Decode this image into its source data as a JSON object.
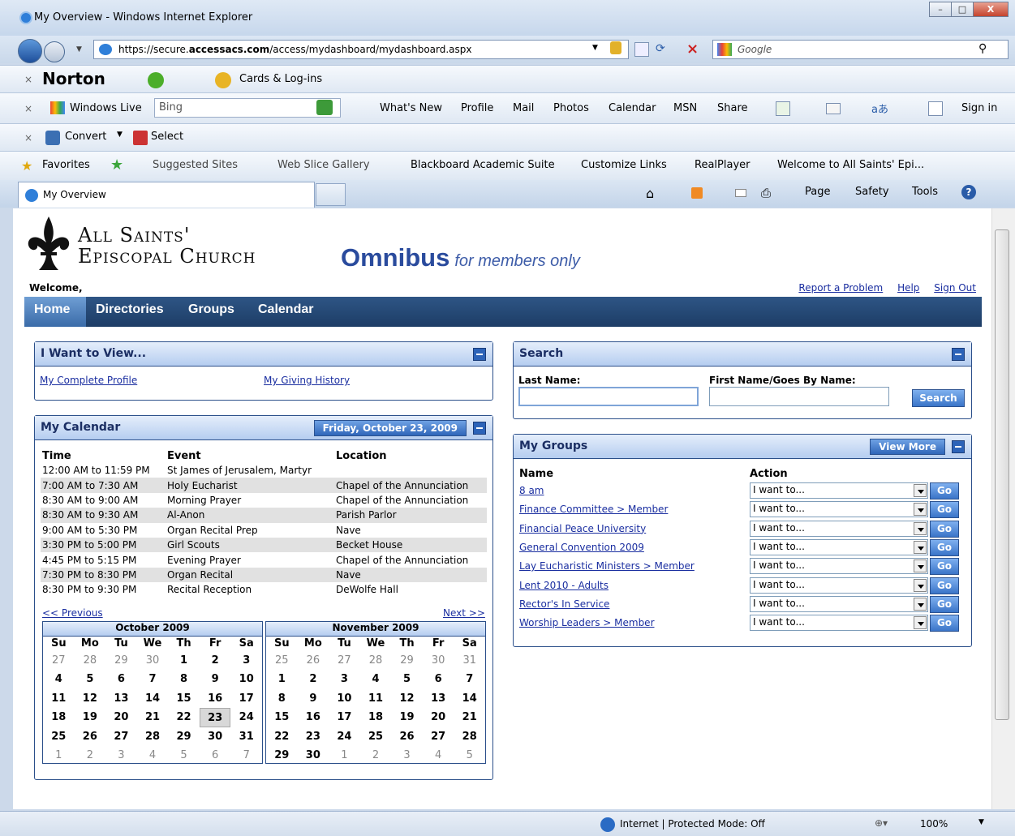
{
  "window": {
    "title": "My Overview - Windows Internet Explorer",
    "minimize": "–",
    "maximize": "□",
    "close": "X"
  },
  "address": {
    "prefix": "https://secure.",
    "domain": "accessacs.com",
    "path": "/access/mydashboard/mydashboard.aspx"
  },
  "search_engine": {
    "placeholder": "Google"
  },
  "norton": {
    "brand": "Norton",
    "cards": "Cards & Log-ins"
  },
  "live": {
    "brand": "Windows Live",
    "search": "Bing",
    "items": [
      "What's New",
      "Profile",
      "Mail",
      "Photos",
      "Calendar",
      "MSN",
      "Share"
    ],
    "signin": "Sign in"
  },
  "convert": {
    "convert": "Convert",
    "select": "Select"
  },
  "favorites": {
    "label": "Favorites",
    "items": [
      "Suggested Sites",
      "Web Slice Gallery",
      "Blackboard Academic Suite",
      "Customize Links",
      "RealPlayer",
      "Welcome to All Saints' Epi..."
    ]
  },
  "tab": {
    "label": "My Overview"
  },
  "commandbar": {
    "page": "Page",
    "safety": "Safety",
    "tools": "Tools"
  },
  "site": {
    "logo_line1": "All Saints'",
    "logo_line2": "Episcopal Church",
    "title": "Omnibus",
    "subtitle": "for members only",
    "welcome": "Welcome,",
    "links": [
      "Report a Problem",
      "Help",
      "Sign Out"
    ]
  },
  "nav": [
    "Home",
    "Directories",
    "Groups",
    "Calendar"
  ],
  "iwant": {
    "title": "I Want to View...",
    "links": [
      "My Complete Profile",
      "My Giving History"
    ]
  },
  "calendar": {
    "title": "My Calendar",
    "date": "Friday, October 23, 2009",
    "headers": [
      "Time",
      "Event",
      "Location"
    ],
    "events": [
      [
        "12:00 AM to 11:59 PM",
        "St James of Jerusalem, Martyr",
        ""
      ],
      [
        "7:00 AM to 7:30 AM",
        "Holy Eucharist",
        "Chapel of the Annunciation"
      ],
      [
        "8:30 AM to 9:00 AM",
        "Morning Prayer",
        "Chapel of the Annunciation"
      ],
      [
        "8:30 AM to 9:30 AM",
        "Al-Anon",
        "Parish Parlor"
      ],
      [
        "9:00 AM to 5:30 PM",
        "Organ Recital Prep",
        "Nave"
      ],
      [
        "3:30 PM to 5:00 PM",
        "Girl Scouts",
        "Becket House"
      ],
      [
        "4:45 PM to 5:15 PM",
        "Evening Prayer",
        "Chapel of the Annunciation"
      ],
      [
        "7:30 PM to 8:30 PM",
        "Organ Recital",
        "Nave"
      ],
      [
        "8:30 PM to 9:30 PM",
        "Recital Reception",
        "DeWolfe Hall"
      ]
    ],
    "prev": "<< Previous",
    "next": "Next >>",
    "dow": [
      "Su",
      "Mo",
      "Tu",
      "We",
      "Th",
      "Fr",
      "Sa"
    ],
    "months": [
      {
        "name": "October 2009",
        "days": [
          [
            "27",
            1
          ],
          [
            "28",
            1
          ],
          [
            "29",
            1
          ],
          [
            "30",
            1
          ],
          [
            "1",
            0
          ],
          [
            "2",
            0
          ],
          [
            "3",
            0
          ],
          [
            "4",
            0
          ],
          [
            "5",
            0
          ],
          [
            "6",
            0
          ],
          [
            "7",
            0
          ],
          [
            "8",
            0
          ],
          [
            "9",
            0
          ],
          [
            "10",
            0
          ],
          [
            "11",
            0
          ],
          [
            "12",
            0
          ],
          [
            "13",
            0
          ],
          [
            "14",
            0
          ],
          [
            "15",
            0
          ],
          [
            "16",
            0
          ],
          [
            "17",
            0
          ],
          [
            "18",
            0
          ],
          [
            "19",
            0
          ],
          [
            "20",
            0
          ],
          [
            "21",
            0
          ],
          [
            "22",
            0
          ],
          [
            "23",
            2
          ],
          [
            "24",
            0
          ],
          [
            "25",
            0
          ],
          [
            "26",
            0
          ],
          [
            "27",
            0
          ],
          [
            "28",
            0
          ],
          [
            "29",
            0
          ],
          [
            "30",
            0
          ],
          [
            "31",
            0
          ],
          [
            "1",
            1
          ],
          [
            "2",
            1
          ],
          [
            "3",
            1
          ],
          [
            "4",
            1
          ],
          [
            "5",
            1
          ],
          [
            "6",
            1
          ],
          [
            "7",
            1
          ]
        ]
      },
      {
        "name": "November 2009",
        "days": [
          [
            "25",
            1
          ],
          [
            "26",
            1
          ],
          [
            "27",
            1
          ],
          [
            "28",
            1
          ],
          [
            "29",
            1
          ],
          [
            "30",
            1
          ],
          [
            "31",
            1
          ],
          [
            "1",
            0
          ],
          [
            "2",
            0
          ],
          [
            "3",
            0
          ],
          [
            "4",
            0
          ],
          [
            "5",
            0
          ],
          [
            "6",
            0
          ],
          [
            "7",
            0
          ],
          [
            "8",
            0
          ],
          [
            "9",
            0
          ],
          [
            "10",
            0
          ],
          [
            "11",
            0
          ],
          [
            "12",
            0
          ],
          [
            "13",
            0
          ],
          [
            "14",
            0
          ],
          [
            "15",
            0
          ],
          [
            "16",
            0
          ],
          [
            "17",
            0
          ],
          [
            "18",
            0
          ],
          [
            "19",
            0
          ],
          [
            "20",
            0
          ],
          [
            "21",
            0
          ],
          [
            "22",
            0
          ],
          [
            "23",
            0
          ],
          [
            "24",
            0
          ],
          [
            "25",
            0
          ],
          [
            "26",
            0
          ],
          [
            "27",
            0
          ],
          [
            "28",
            0
          ],
          [
            "29",
            0
          ],
          [
            "30",
            0
          ],
          [
            "1",
            1
          ],
          [
            "2",
            1
          ],
          [
            "3",
            1
          ],
          [
            "4",
            1
          ],
          [
            "5",
            1
          ]
        ]
      }
    ]
  },
  "search": {
    "title": "Search",
    "last_label": "Last Name:",
    "first_label": "First Name/Goes By Name:",
    "button": "Search"
  },
  "groups": {
    "title": "My Groups",
    "view_more": "View More",
    "col_name": "Name",
    "col_action": "Action",
    "action_value": "I want to...",
    "go": "Go",
    "items": [
      "8 am",
      "Finance Committee > Member",
      "Financial Peace University",
      "General Convention 2009",
      "Lay Eucharistic Ministers > Member",
      "Lent 2010 - Adults",
      "Rector's In Service",
      "Worship Leaders > Member"
    ]
  },
  "status": {
    "zone": "Internet | Protected Mode: Off",
    "zoom": "100%"
  }
}
